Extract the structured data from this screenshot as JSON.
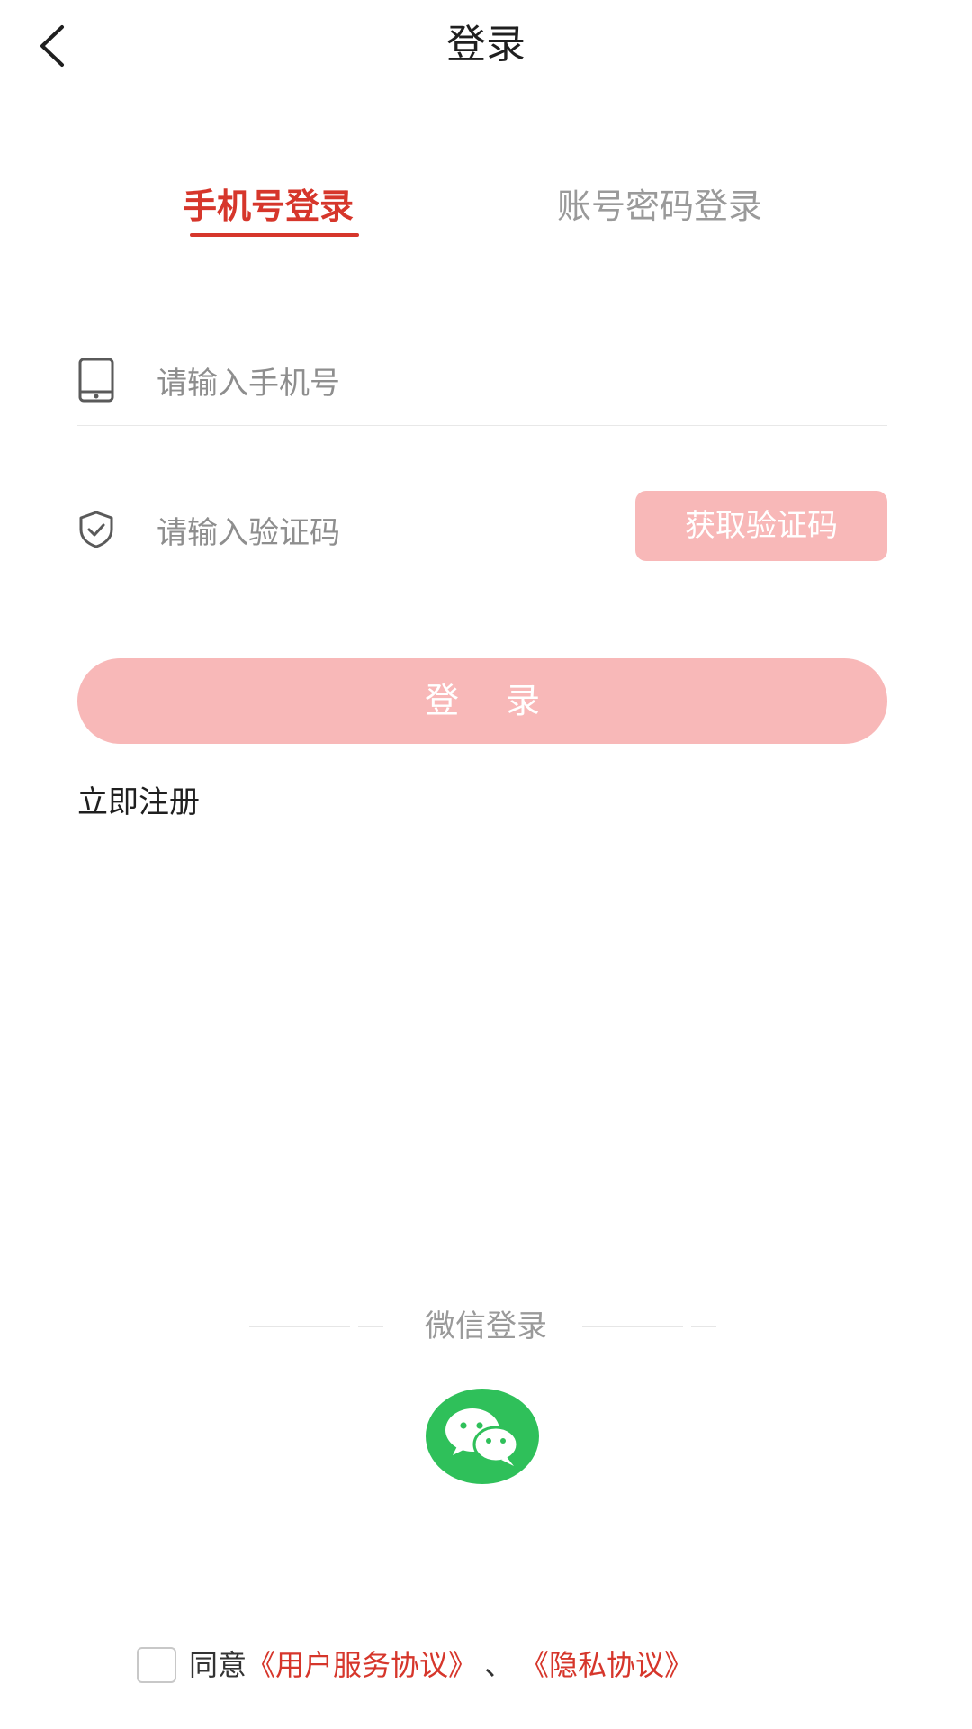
{
  "header": {
    "title": "登录",
    "back_icon": "chevron-left-icon"
  },
  "tabs": {
    "phone_login": "手机号登录",
    "account_login": "账号密码登录",
    "active": "phone_login",
    "active_color": "#d6362b",
    "inactive_color": "#9a9a9a"
  },
  "form": {
    "phone": {
      "icon": "mobile-phone-icon",
      "placeholder": "请输入手机号",
      "value": ""
    },
    "code": {
      "icon": "shield-check-icon",
      "placeholder": "请输入验证码",
      "value": "",
      "get_code_label": "获取验证码"
    },
    "login_label": "登 录",
    "register_label": "立即注册",
    "button_color": "#f8b8b8"
  },
  "wechat": {
    "title": "微信登录",
    "icon": "wechat-icon",
    "color": "#2fc05a"
  },
  "agreement": {
    "checked": false,
    "prefix": "同意",
    "user_agreement": "《用户服务协议》",
    "separator": "、",
    "privacy_agreement": "《隐私协议》",
    "link_color": "#d6362b"
  }
}
